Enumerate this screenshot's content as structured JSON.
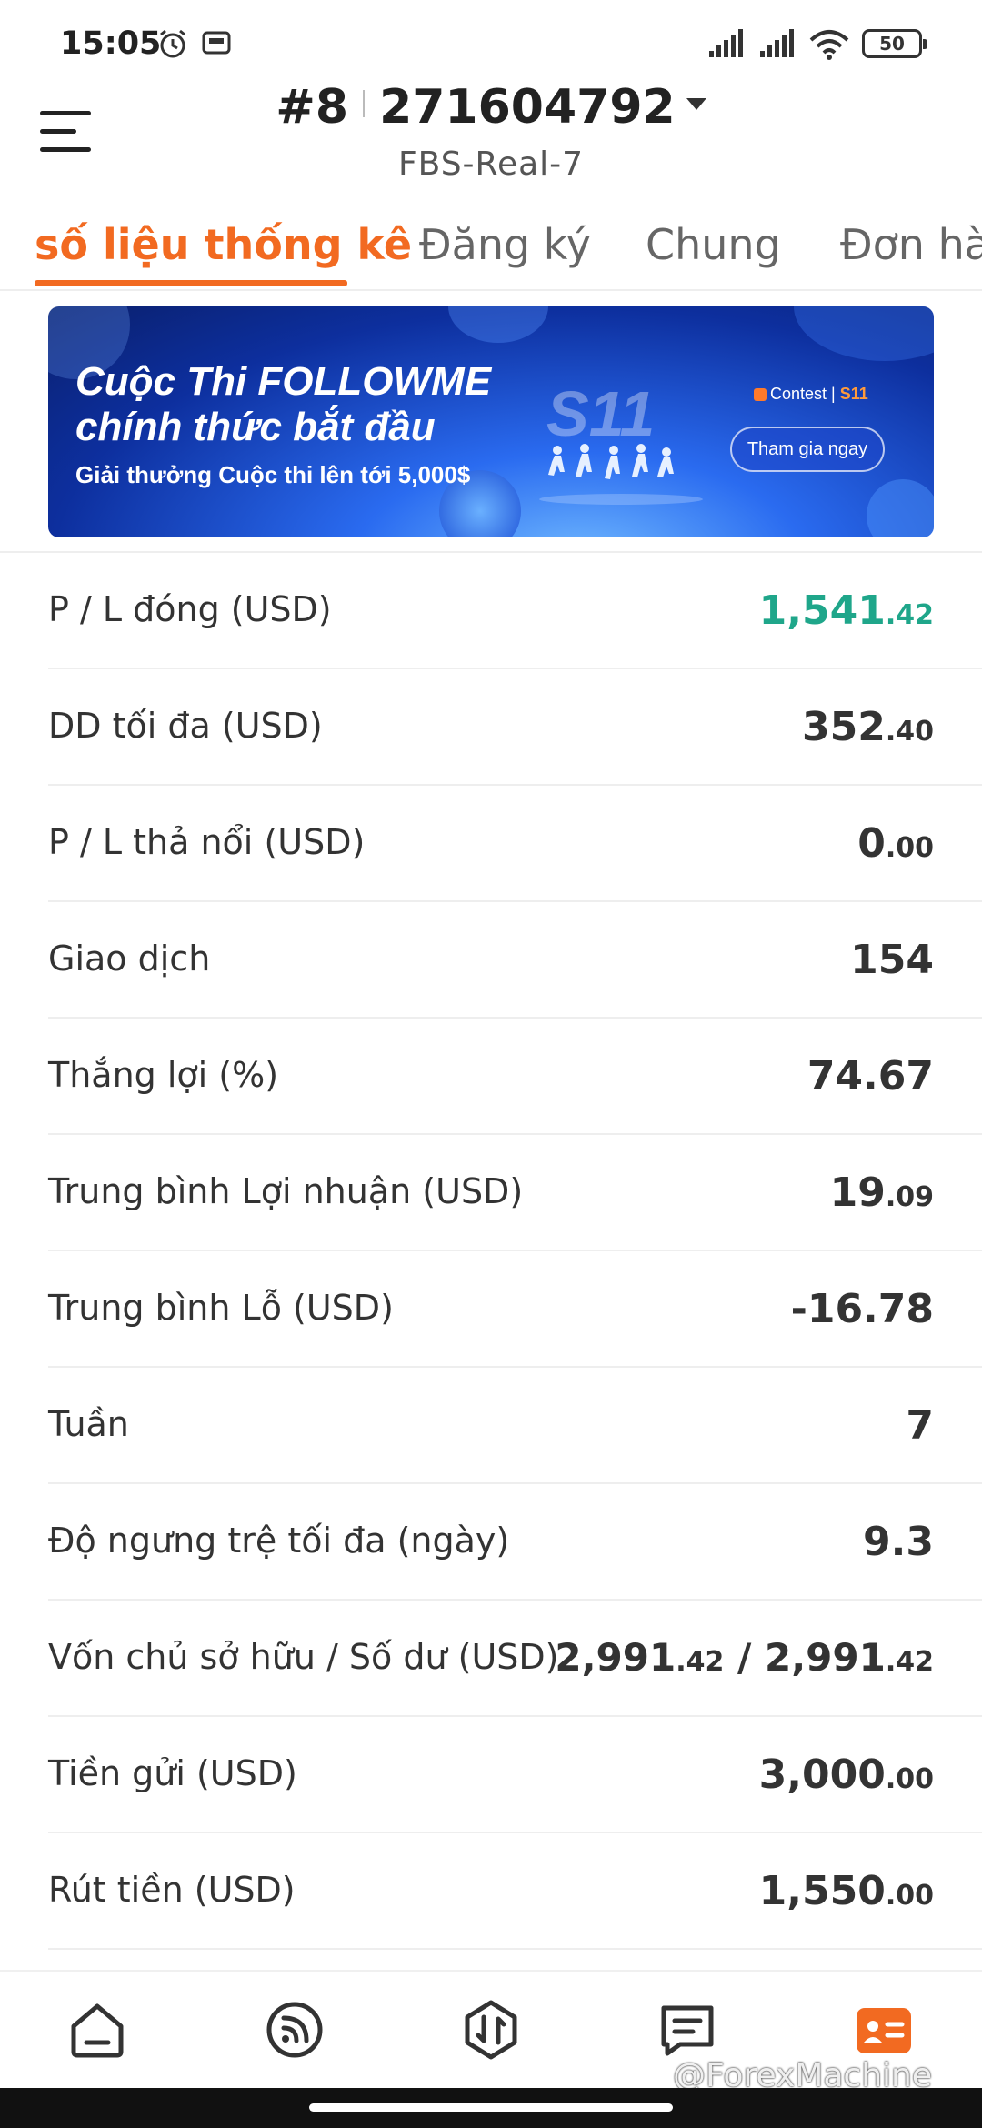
{
  "status_bar": {
    "time": "15:05",
    "battery": "50",
    "icons": [
      "alarm-icon",
      "cassette-icon",
      "signal-icon",
      "signal-icon",
      "wifi-icon",
      "battery-icon"
    ]
  },
  "header": {
    "account_index": "#8",
    "account_number": "271604792",
    "server": "FBS-Real-7"
  },
  "tabs": [
    {
      "label": "số liệu thống kê",
      "active": true
    },
    {
      "label": "Đăng ký",
      "active": false
    },
    {
      "label": "Chung",
      "active": false
    },
    {
      "label": "Đơn hàng",
      "active": false
    }
  ],
  "banner": {
    "line1": "Cuộc Thi FOLLOWME",
    "line2": "chính thức bắt đầu",
    "line3": "Giải thưởng Cuộc thi lên tới 5,000$",
    "badge": "S11",
    "contest_label": "Contest",
    "contest_season": "S11",
    "join_button": "Tham gia ngay"
  },
  "stats": [
    {
      "label": "P / L đóng (USD)",
      "int": "1,541",
      "dec": ".42",
      "color": "#1fa68a"
    },
    {
      "label": "DD tối đa (USD)",
      "int": "352",
      "dec": ".40"
    },
    {
      "label": "P / L thả nổi (USD)",
      "int": "0",
      "dec": ".00"
    },
    {
      "label": "Giao dịch",
      "int": "154",
      "dec": ""
    },
    {
      "label": "Thắng lợi (%)",
      "int": "74.67",
      "dec": ""
    },
    {
      "label": "Trung bình Lợi nhuận (USD)",
      "int": "19",
      "dec": ".09"
    },
    {
      "label": "Trung bình Lỗ (USD)",
      "int": "-16.78",
      "dec": ""
    },
    {
      "label": "Tuần",
      "int": "7",
      "dec": ""
    },
    {
      "label": "Độ ngưng trệ tối đa (ngày)",
      "int": "9.3",
      "dec": ""
    },
    {
      "label": "Vốn chủ sở hữu / Số dư (USD)",
      "int": "2,991",
      "dec": ".42",
      "int2": "2,991",
      "dec2": ".42"
    },
    {
      "label": "Tiền gửi (USD)",
      "int": "3,000",
      "dec": ".00"
    },
    {
      "label": "Rút tiền (USD)",
      "int": "1,550",
      "dec": ".00"
    }
  ],
  "bottom_nav": [
    {
      "icon": "home-icon",
      "active": false
    },
    {
      "icon": "signal-feed-icon",
      "active": false
    },
    {
      "icon": "trade-icon",
      "active": false
    },
    {
      "icon": "message-icon",
      "active": false
    },
    {
      "icon": "account-card-icon",
      "active": true
    }
  ],
  "watermark": "@ForexMachine",
  "colors": {
    "accent": "#f26a21",
    "profit": "#1fa68a"
  }
}
